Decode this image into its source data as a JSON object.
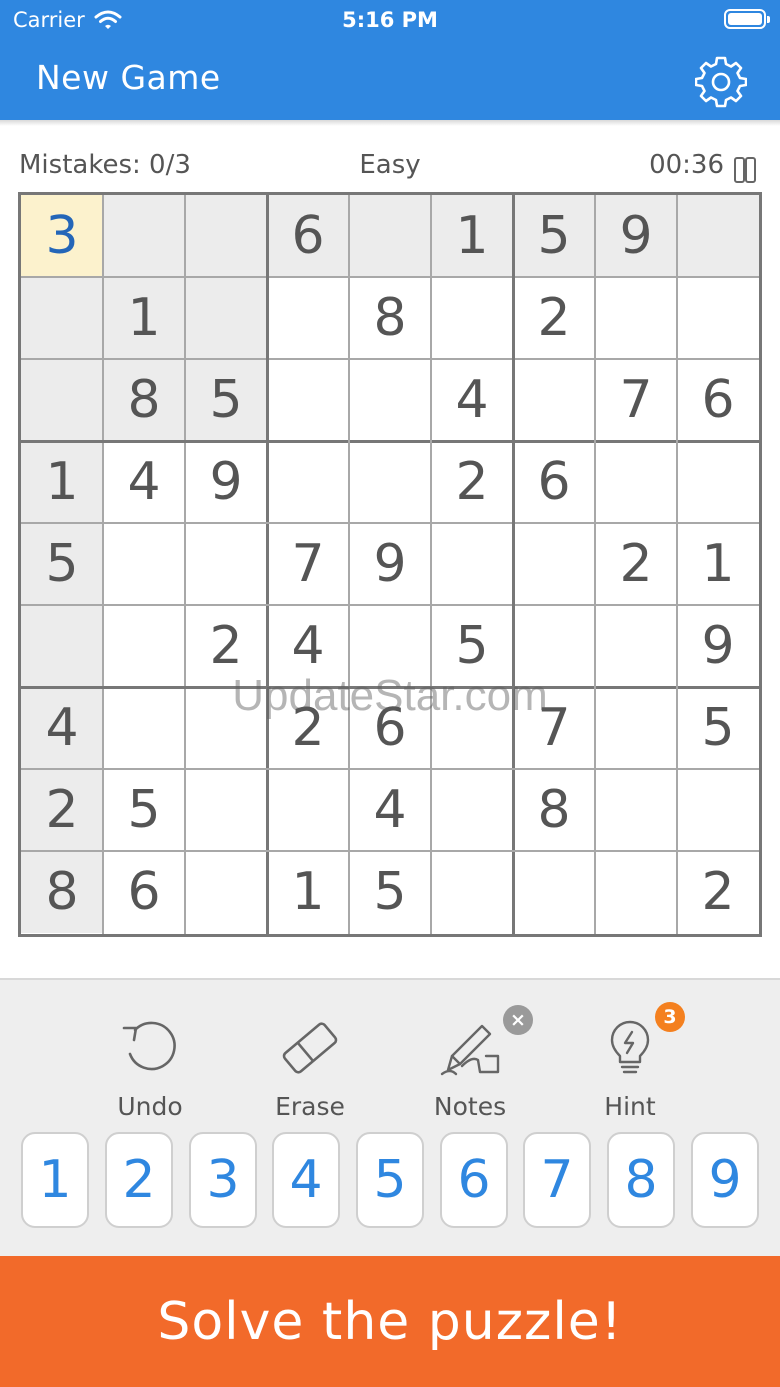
{
  "status": {
    "carrier": "Carrier",
    "time": "5:16 PM"
  },
  "nav": {
    "title": "New Game",
    "settings_icon": "gear-icon"
  },
  "info": {
    "mistakes": "Mistakes: 0/3",
    "difficulty": "Easy",
    "timer": "00:36"
  },
  "board": {
    "rows": [
      [
        "3",
        "",
        "",
        "6",
        "",
        "1",
        "5",
        "9",
        ""
      ],
      [
        "",
        "1",
        "",
        "",
        "8",
        "",
        "2",
        "",
        ""
      ],
      [
        "",
        "8",
        "5",
        "",
        "",
        "4",
        "",
        "7",
        "6"
      ],
      [
        "1",
        "4",
        "9",
        "",
        "",
        "2",
        "6",
        "",
        ""
      ],
      [
        "5",
        "",
        "",
        "7",
        "9",
        "",
        "",
        "2",
        "1"
      ],
      [
        "",
        "",
        "2",
        "4",
        "",
        "5",
        "",
        "",
        "9"
      ],
      [
        "4",
        "",
        "",
        "2",
        "6",
        "",
        "7",
        "",
        "5"
      ],
      [
        "2",
        "5",
        "",
        "",
        "4",
        "",
        "8",
        "",
        ""
      ],
      [
        "8",
        "6",
        "",
        "1",
        "5",
        "",
        "",
        "",
        "2"
      ]
    ],
    "selected": [
      0,
      0
    ]
  },
  "watermark": "UpdateStar.com",
  "tools": {
    "undo": "Undo",
    "erase": "Erase",
    "notes": "Notes",
    "notes_badge": "×",
    "hint": "Hint",
    "hint_badge": "3"
  },
  "numpad": [
    "1",
    "2",
    "3",
    "4",
    "5",
    "6",
    "7",
    "8",
    "9"
  ],
  "banner": "Solve the puzzle!",
  "colors": {
    "header": "#2f87e0",
    "banner": "#f26a2a",
    "selected_cell": "#fcf2cd",
    "accent_digits": "#2f87e0"
  }
}
